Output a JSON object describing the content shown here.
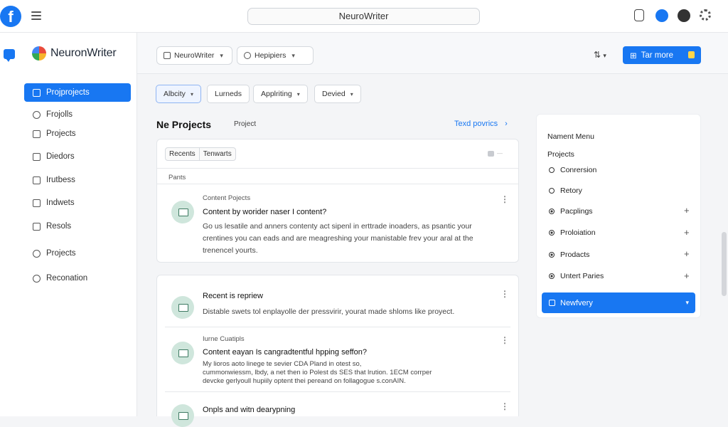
{
  "topbar": {
    "logo_letter": "f",
    "search_placeholder": "NeuroWriter"
  },
  "sidebar": {
    "brand": "NeuronWriter",
    "items": [
      {
        "label": "Projprojects"
      },
      {
        "label": "Frojolls"
      },
      {
        "label": "Projects"
      },
      {
        "label": "Diedors"
      },
      {
        "label": "Irutbess"
      },
      {
        "label": "Indwets"
      },
      {
        "label": "Resols"
      },
      {
        "label": "Projects"
      },
      {
        "label": "Reconation"
      }
    ]
  },
  "toolbar": {
    "workspace": "NeuroWriter",
    "hepiers": "Hepipiers",
    "action_button": "Tar more",
    "sort_icon": "⇅"
  },
  "filters": [
    "Albcity",
    "Lurneds",
    "Applriting",
    "Devied"
  ],
  "main": {
    "title": "Ne Projects",
    "subtitle": "Project",
    "link": "Texd povrics",
    "tabs": [
      "Recents",
      "Tenwarts"
    ],
    "panel_label": "Pants",
    "items": [
      {
        "caption": "Content Pojects",
        "title": "Content by worider naser I content?",
        "body_lines": [
          "Go us lesatile and anners contenty act sipenl in erttrade inoaders, as psantic your",
          "crentines you can eads and are meagreshing your manistable frev your aral at the",
          "trenencel yourts."
        ]
      },
      {
        "caption": "",
        "title": "Recent is repriew",
        "body_lines": [
          "Distable swets tol enplayolle der pressvirir, yourat made shloms like proyect."
        ]
      },
      {
        "caption": "Iurne Cuatipls",
        "title": "Content eayan Is cangradtentful hpping seffon?",
        "body_lines": [
          "My lioros aoto linege   te sevier CDA   Pland in otest so,",
          "cummonwiessm, lbdy, a    net then io Polest ds SES that lrution. 1ECM corrper",
          "devcke gerlyoull hupiily optent thei pereand on follagogue s.conAIN."
        ]
      },
      {
        "caption": "",
        "title": "Onpls and witn dearypning",
        "body_lines": []
      }
    ]
  },
  "right_panel": {
    "heading": "Nament Menu",
    "section": "Projects",
    "items": [
      {
        "label": "Conrersion",
        "plus": ""
      },
      {
        "label": "Retory",
        "plus": ""
      },
      {
        "label": "Pacplings",
        "plus": "+"
      },
      {
        "label": "Proloiation",
        "plus": "+"
      },
      {
        "label": "Prodacts",
        "plus": "+"
      },
      {
        "label": "Untert Paries",
        "plus": "+"
      }
    ],
    "select_label": "Newfvery"
  },
  "colors": {
    "accent": "#1877f2",
    "icon_bg": "#cfe6dc"
  }
}
